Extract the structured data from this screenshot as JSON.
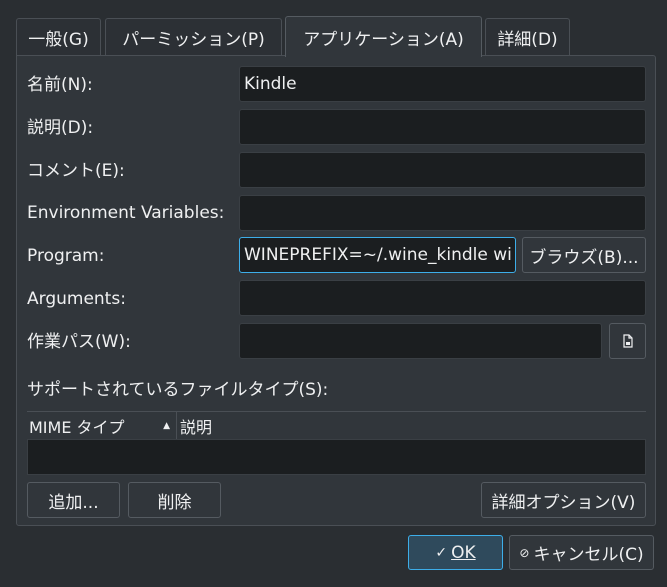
{
  "tabs": [
    {
      "label": "一般(G)"
    },
    {
      "label": "パーミッション(P)"
    },
    {
      "label": "アプリケーション(A)"
    },
    {
      "label": "詳細(D)"
    }
  ],
  "form": {
    "name_label": "名前(N):",
    "name_value": "Kindle",
    "description_label": "説明(D):",
    "description_value": "",
    "comment_label": "コメント(E):",
    "comment_value": "",
    "env_label": "Environment Variables:",
    "env_value": "",
    "program_label": "Program:",
    "program_value": "WINEPREFIX=~/.wine_kindle wi",
    "browse_label": "ブラウズ(B)...",
    "arguments_label": "Arguments:",
    "arguments_value": "",
    "workdir_label": "作業パス(W):",
    "workdir_value": "",
    "workdir_icon": "file-icon"
  },
  "filetypes": {
    "label": "サポートされているファイルタイプ(S):",
    "columns": [
      "MIME タイプ",
      "説明"
    ],
    "rows": [],
    "add_label": "追加...",
    "remove_label": "削除",
    "advanced_label": "詳細オプション(V)"
  },
  "dialog": {
    "ok_label": "OK",
    "cancel_label": "キャンセル(C)"
  },
  "colors": {
    "accent": "#3daee9",
    "background": "#2a2e32",
    "panel": "#31363b",
    "field": "#1b1e20"
  }
}
